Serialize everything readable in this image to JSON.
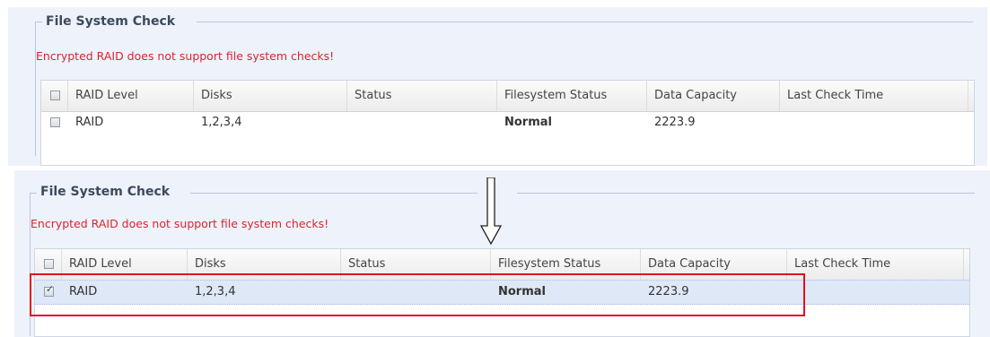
{
  "panels": [
    {
      "legend": "File System Check",
      "warning": "Encrypted RAID does not support file system checks!",
      "columns": [
        "RAID Level",
        "Disks",
        "Status",
        "Filesystem Status",
        "Data Capacity",
        "Last Check Time"
      ],
      "row": {
        "checked": false,
        "raid_level": "RAID",
        "disks": "1,2,3,4",
        "status": "",
        "filesystem_status": "Normal",
        "data_capacity": "2223.9",
        "last_check_time": ""
      }
    },
    {
      "legend": "File System Check",
      "warning": "Encrypted RAID does not support file system checks!",
      "columns": [
        "RAID Level",
        "Disks",
        "Status",
        "Filesystem Status",
        "Data Capacity",
        "Last Check Time"
      ],
      "row": {
        "checked": true,
        "raid_level": "RAID",
        "disks": "1,2,3,4",
        "status": "",
        "filesystem_status": "Normal",
        "data_capacity": "2223.9",
        "last_check_time": ""
      }
    }
  ],
  "colors": {
    "warning": "#d8262e",
    "highlight": "#e3101d",
    "selected_row": "#dfe8f6"
  },
  "icons": {
    "transition": "down-arrow-icon",
    "checkbox_checked": "checkmark-icon"
  }
}
